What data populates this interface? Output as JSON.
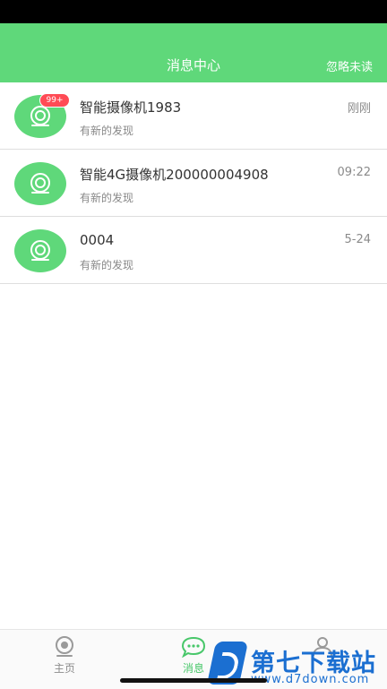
{
  "header": {
    "title": "消息中心",
    "action_label": "忽略未读",
    "color": "#5fd87a"
  },
  "messages": [
    {
      "title": "智能摄像机1983",
      "subtitle": "有新的发现",
      "time": "刚刚",
      "badge": "99+",
      "icon": "camera-icon"
    },
    {
      "title": "智能4G摄像机200000004908",
      "subtitle": "有新的发现",
      "time": "09:22",
      "icon": "camera-icon"
    },
    {
      "title": "0004",
      "subtitle": "有新的发现",
      "time": "5-24",
      "icon": "camera-icon"
    }
  ],
  "tabbar": {
    "tabs": [
      {
        "label": "主页",
        "icon": "camera-icon",
        "active": false
      },
      {
        "label": "消息",
        "icon": "chat-bubble-icon",
        "active": true
      },
      {
        "label": "",
        "icon": "user-icon",
        "active": false
      }
    ],
    "accent": "#48c76a"
  },
  "watermark": {
    "text": "第七下载站",
    "url": "www.d7down.com"
  }
}
